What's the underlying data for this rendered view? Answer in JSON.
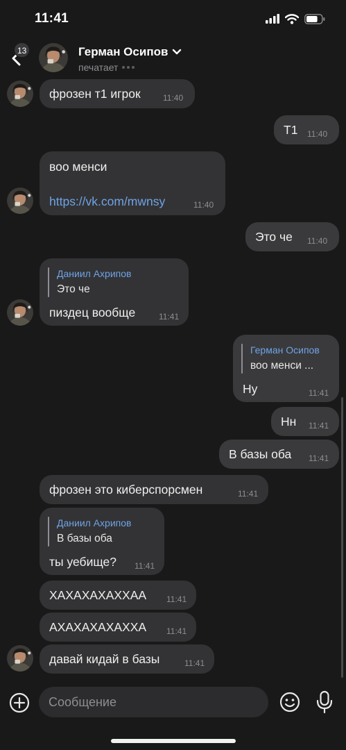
{
  "status_bar": {
    "time": "11:41",
    "battery_level": 0.75
  },
  "header": {
    "back_badge": "13",
    "contact_name": "Герман Осипов",
    "status": "печатает"
  },
  "messages": [
    {
      "text": "фрозен т1 игрок",
      "time": "11:40"
    },
    {
      "text": "Т1",
      "time": "11:40"
    },
    {
      "text": "воо менси",
      "link": "https://vk.com/mwnsy",
      "time": "11:40"
    },
    {
      "text": "Это че",
      "time": "11:40"
    },
    {
      "reply_author": "Даниил Ахрипов",
      "reply_text": "Это че",
      "text": "пиздец вообще",
      "time": "11:41"
    },
    {
      "reply_author": "Герман Осипов",
      "reply_text": "воо менси ...",
      "text": "Ну",
      "time": "11:41"
    },
    {
      "text": "Нн",
      "time": "11:41"
    },
    {
      "text": "В базы оба",
      "time": "11:41"
    },
    {
      "text": "фрозен это киберспорсмен",
      "time": "11:41"
    },
    {
      "reply_author": "Даниил Ахрипов",
      "reply_text": "В базы оба",
      "text": "ты уебище?",
      "time": "11:41"
    },
    {
      "text": "ХАХАХАХАХХАА",
      "time": "11:41"
    },
    {
      "text": "АХАХАХАХАХХА",
      "time": "11:41"
    },
    {
      "text": "давай кидай в базы",
      "time": "11:41"
    }
  ],
  "composer": {
    "placeholder": "Сообщение"
  },
  "colors": {
    "background": "#191919",
    "bubble": "#333335",
    "link": "#6fa3e6",
    "time": "#8e8e93"
  }
}
